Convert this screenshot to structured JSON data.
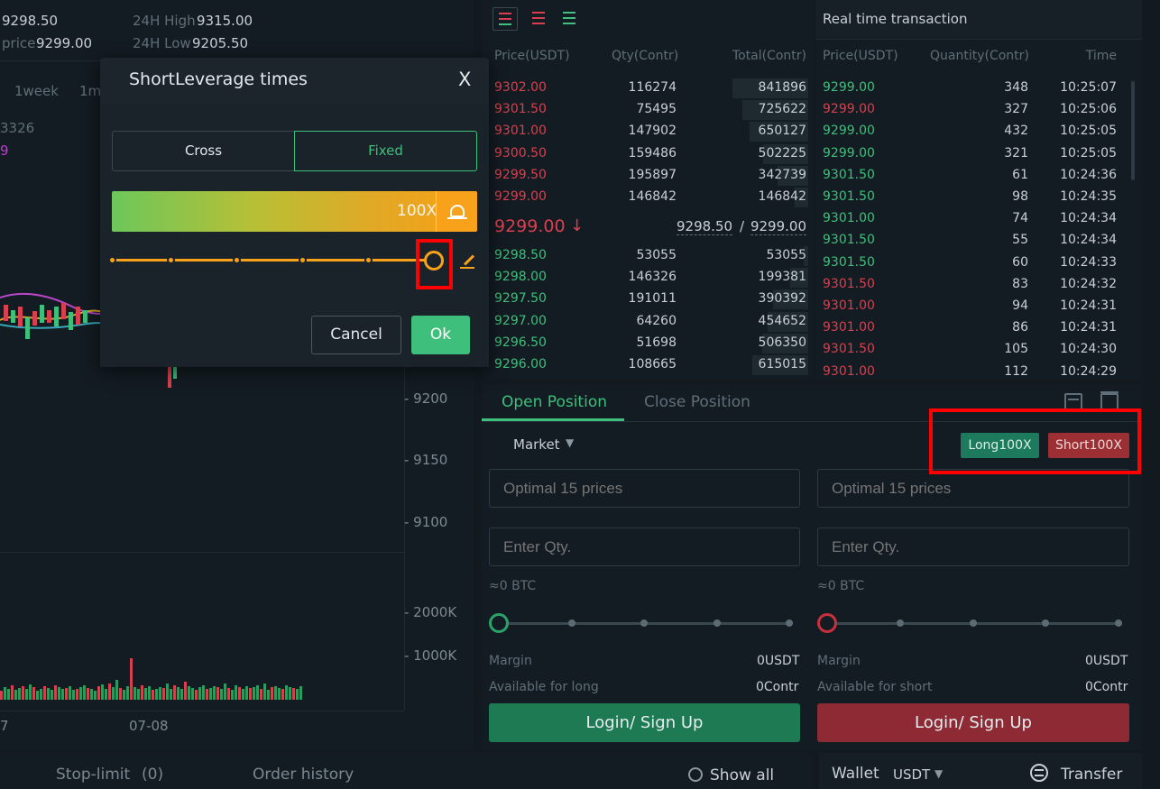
{
  "ticker": {
    "last_price": "9298.50",
    "price_label": "price",
    "price_value": "9299.00",
    "high_label": "24H High",
    "high_value": "9315.00",
    "low_label": "24H Low",
    "low_value": "9205.50"
  },
  "chart": {
    "period_1week": "1week",
    "period_1m": "1m",
    "indicator_1": "3326",
    "indicator_2": "9",
    "axis_9200": "- 9200",
    "axis_9150": "- 9150",
    "axis_9100": "- 9100",
    "axis_2000k": "- 2000K",
    "axis_1000k": "- 1000K",
    "date_left": "7",
    "date_0708": "07-08"
  },
  "orderbook": {
    "headers": [
      "Price(USDT)",
      "Qty(Contr)",
      "Total(Contr)"
    ],
    "asks": [
      [
        "9302.00",
        "116274",
        "841896"
      ],
      [
        "9301.50",
        "75495",
        "725622"
      ],
      [
        "9301.00",
        "147902",
        "650127"
      ],
      [
        "9300.50",
        "159486",
        "502225"
      ],
      [
        "9299.50",
        "195897",
        "342739"
      ],
      [
        "9299.00",
        "146842",
        "146842"
      ]
    ],
    "last": "9299.00",
    "last_arrow": "↓",
    "mark_index": "9298.50",
    "slash": "/",
    "mark_price": "9299.00",
    "bids": [
      [
        "9298.50",
        "53055",
        "53055"
      ],
      [
        "9298.00",
        "146326",
        "199381"
      ],
      [
        "9297.50",
        "191011",
        "390392"
      ],
      [
        "9297.00",
        "64260",
        "454652"
      ],
      [
        "9296.50",
        "51698",
        "506350"
      ],
      [
        "9296.00",
        "108665",
        "615015"
      ]
    ],
    "depth_icons": [
      "order-book-both-icon",
      "order-book-asks-icon",
      "order-book-bids-icon"
    ]
  },
  "trades": {
    "title": "Real time transaction",
    "headers": [
      "Price(USDT)",
      "Quantity(Contr)",
      "Time"
    ],
    "rows": [
      [
        "9299.00",
        "348",
        "10:25:07",
        "green"
      ],
      [
        "9299.00",
        "327",
        "10:25:06",
        "red"
      ],
      [
        "9299.00",
        "432",
        "10:25:05",
        "green"
      ],
      [
        "9299.00",
        "321",
        "10:25:05",
        "green"
      ],
      [
        "9301.50",
        "61",
        "10:24:36",
        "green"
      ],
      [
        "9301.50",
        "98",
        "10:24:35",
        "green"
      ],
      [
        "9301.00",
        "74",
        "10:24:34",
        "green"
      ],
      [
        "9301.50",
        "55",
        "10:24:34",
        "green"
      ],
      [
        "9301.50",
        "60",
        "10:24:33",
        "green"
      ],
      [
        "9301.50",
        "83",
        "10:24:32",
        "red"
      ],
      [
        "9301.00",
        "94",
        "10:24:31",
        "red"
      ],
      [
        "9301.00",
        "86",
        "10:24:31",
        "red"
      ],
      [
        "9301.50",
        "105",
        "10:24:30",
        "red"
      ],
      [
        "9301.00",
        "112",
        "10:24:29",
        "red"
      ]
    ]
  },
  "form": {
    "tab_open": "Open Position",
    "tab_close": "Close Position",
    "order_type": "Market",
    "long_badge": "Long100X",
    "short_badge": "Short100X",
    "price_placeholder_long": "Optimal 15 prices",
    "price_placeholder_short": "Optimal 15 prices",
    "qty_placeholder_long": "Enter Qty.",
    "qty_placeholder_short": "Enter Qty.",
    "btc_long": "≈0 BTC",
    "btc_short": "≈0 BTC",
    "margin_label_long": "Margin",
    "margin_value_long": "0USDT",
    "margin_label_short": "Margin",
    "margin_value_short": "0USDT",
    "avail_long_label": "Available for long",
    "avail_long_value": "0Contr",
    "avail_short_label": "Available for short",
    "avail_short_value": "0Contr",
    "login_long": "Login/ Sign Up",
    "login_short": "Login/ Sign Up"
  },
  "bottom": {
    "stop_limit": "Stop-limit",
    "stop_limit_count": "(0)",
    "order_history": "Order history",
    "show_all": "Show all",
    "wallet": "Wallet",
    "wallet_currency": "USDT",
    "transfer": "Transfer"
  },
  "modal": {
    "title": "ShortLeverage times",
    "close": "X",
    "mode_cross": "Cross",
    "mode_fixed": "Fixed",
    "leverage_value": "100X",
    "leverage_level": 1.0,
    "cancel": "Cancel",
    "ok": "Ok"
  },
  "colors": {
    "green": "#3fbf7c",
    "red": "#d8404f",
    "accent_orange": "#f7a21a",
    "long_btn": "#1e7a52",
    "short_btn": "#8e2a33"
  }
}
